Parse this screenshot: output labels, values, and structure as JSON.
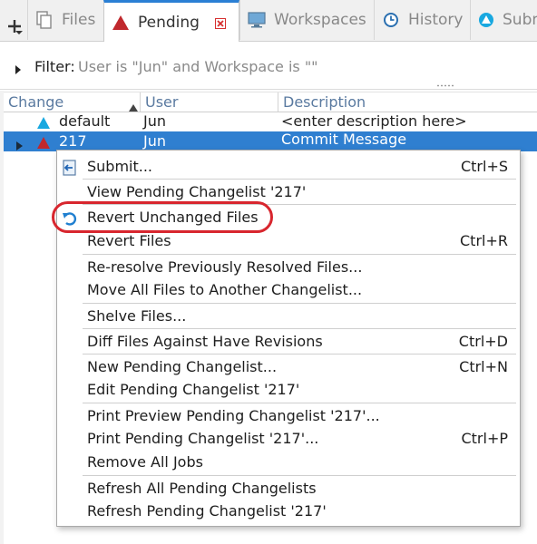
{
  "tabs": [
    {
      "label": "Files",
      "icon": "files-icon"
    },
    {
      "label": "Pending",
      "icon": "pending-changelist-icon",
      "active": true
    },
    {
      "label": "Workspaces",
      "icon": "monitor-icon"
    },
    {
      "label": "History",
      "icon": "clock-icon"
    },
    {
      "label": "Subm",
      "icon": "submitted-icon"
    }
  ],
  "filter": {
    "label": "Filter:",
    "value": "User is \"Jun\" and Workspace is \"\""
  },
  "table": {
    "columns": [
      "Change",
      "User",
      "Description"
    ],
    "rows": [
      {
        "change": "default",
        "user": "Jun",
        "description": "<enter description here>"
      },
      {
        "change": "217",
        "user": "Jun",
        "description": "Commit Message"
      }
    ]
  },
  "menu": {
    "items": [
      {
        "label": "Submit...",
        "shortcut": "Ctrl+S",
        "icon": "submit-icon"
      },
      {
        "label": "View Pending Changelist '217'",
        "shortcut": ""
      },
      {
        "label": "Revert Unchanged Files",
        "shortcut": "",
        "icon": "revert-icon"
      },
      {
        "label": "Revert Files",
        "shortcut": "Ctrl+R"
      },
      {
        "label": "Re-resolve Previously Resolved Files...",
        "shortcut": ""
      },
      {
        "label": "Move All Files to Another Changelist...",
        "shortcut": ""
      },
      {
        "label": "Shelve Files...",
        "shortcut": ""
      },
      {
        "label": "Diff Files Against Have Revisions",
        "shortcut": "Ctrl+D"
      },
      {
        "label": "New Pending Changelist...",
        "shortcut": "Ctrl+N"
      },
      {
        "label": "Edit Pending Changelist '217'",
        "shortcut": ""
      },
      {
        "label": "Print Preview Pending Changelist '217'...",
        "shortcut": ""
      },
      {
        "label": "Print Pending Changelist '217'...",
        "shortcut": "Ctrl+P"
      },
      {
        "label": "Remove All Jobs",
        "shortcut": ""
      },
      {
        "label": "Refresh All Pending Changelists",
        "shortcut": ""
      },
      {
        "label": "Refresh Pending Changelist '217'",
        "shortcut": ""
      }
    ]
  },
  "colors": {
    "selection": "#2f7fd0",
    "highlight_ring": "#d8262e",
    "active_tab_accent": "#2a7fd4",
    "pending_red": "#c0282d",
    "default_cyan": "#18a8e0"
  }
}
